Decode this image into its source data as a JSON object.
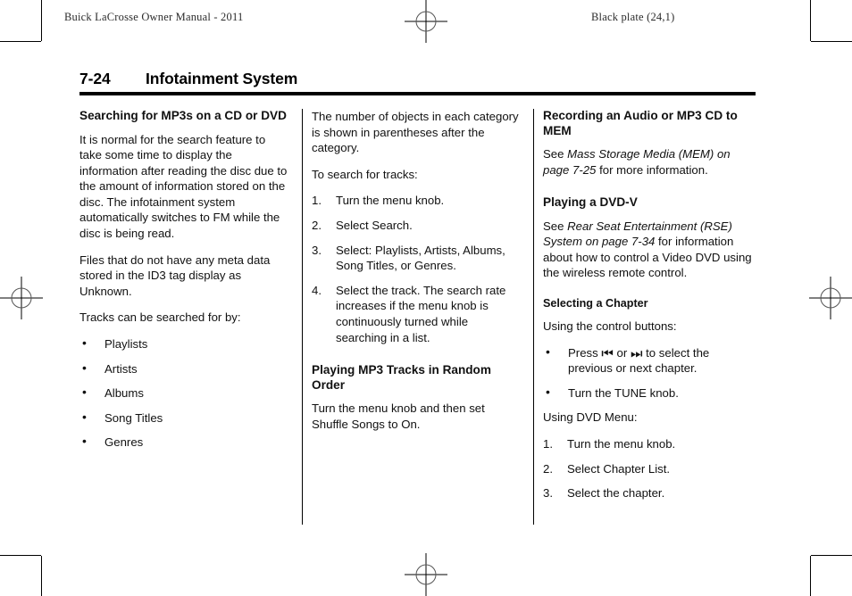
{
  "header": {
    "left": "Buick LaCrosse Owner Manual - 2011",
    "right": "Black plate (24,1)"
  },
  "title": {
    "page_number": "7-24",
    "chapter": "Infotainment System"
  },
  "columns": {
    "col1": {
      "heading": "Searching for MP3s on a CD or DVD",
      "para1": "It is normal for the search feature to take some time to display the information after reading the disc due to the amount of information stored on the disc. The infotainment system automatically switches to FM while the disc is being read.",
      "para2": "Files that do not have any meta data stored in the ID3 tag display as Unknown.",
      "para3": "Tracks can be searched for by:",
      "bullets": [
        "Playlists",
        "Artists",
        "Albums",
        "Song Titles",
        "Genres"
      ]
    },
    "col2": {
      "para1": "The number of objects in each category is shown in parentheses after the category.",
      "para2": "To search for tracks:",
      "steps": [
        {
          "num": "1.",
          "text": "Turn the menu knob."
        },
        {
          "num": "2.",
          "text": "Select Search."
        },
        {
          "num": "3.",
          "text": "Select: Playlists, Artists, Albums, Song Titles, or Genres."
        },
        {
          "num": "4.",
          "text": "Select the track. The search rate increases if the menu knob is continuously turned while searching in a list."
        }
      ],
      "heading2": "Playing MP3 Tracks in Random Order",
      "para3": "Turn the menu knob and then set Shuffle Songs to On."
    },
    "col3": {
      "heading1": "Recording an Audio or MP3 CD to MEM",
      "ref1_lead": "See ",
      "ref1_italic": "Mass Storage Media (MEM) on page 7‑25",
      "ref1_tail": " for more information.",
      "heading2": "Playing a DVD-V",
      "ref2_lead": "See ",
      "ref2_italic": "Rear Seat Entertainment (RSE) System on page 7‑34",
      "ref2_tail": " for information about how to control a Video DVD using the wireless remote control.",
      "subheading": "Selecting a Chapter",
      "para1": "Using the control buttons:",
      "bullet1_lead": "Press ",
      "bullet1_prev_icon": "⏮",
      "bullet1_mid": " or ",
      "bullet1_next_icon": "⏭",
      "bullet1_tail": " to select the previous or next chapter.",
      "bullet2": "Turn the TUNE knob.",
      "para2": "Using DVD Menu:",
      "steps": [
        {
          "num": "1.",
          "text": "Turn the menu knob."
        },
        {
          "num": "2.",
          "text": "Select Chapter List."
        },
        {
          "num": "3.",
          "text": "Select the chapter."
        }
      ]
    }
  },
  "print_marks": {
    "registration_icon": "registration-crosshair",
    "crop_icon": "crop-mark"
  }
}
